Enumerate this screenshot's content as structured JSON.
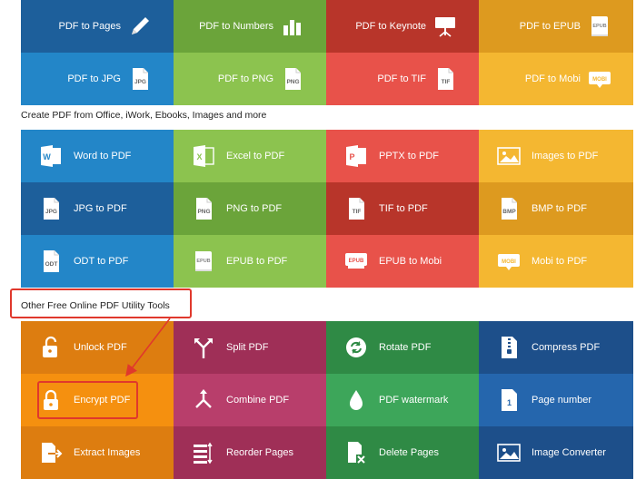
{
  "convert_from_pdf": [
    {
      "label": "PDF to Pages",
      "bg": "#1d5f9b",
      "icon": "pen-icon"
    },
    {
      "label": "PDF to Numbers",
      "bg": "#6ba43a",
      "icon": "bar-chart-icon"
    },
    {
      "label": "PDF to Keynote",
      "bg": "#b8352a",
      "icon": "presentation-icon"
    },
    {
      "label": "PDF to EPUB",
      "bg": "#dd9a1f",
      "icon": "epub-file-icon"
    },
    {
      "label": "PDF to JPG",
      "bg": "#2386c8",
      "icon": "jpg-file-icon",
      "badge": "JPG"
    },
    {
      "label": "PDF to PNG",
      "bg": "#8cc34f",
      "icon": "png-file-icon",
      "badge": "PNG"
    },
    {
      "label": "PDF to TIF",
      "bg": "#e8524a",
      "icon": "tif-file-icon",
      "badge": "TIF"
    },
    {
      "label": "PDF to Mobi",
      "bg": "#f4b731",
      "icon": "mobi-file-icon",
      "badge": "MOBI"
    }
  ],
  "section_create": {
    "title": "Create PDF from Office, iWork, Ebooks, Images and more"
  },
  "create_pdf": [
    {
      "label": "Word to PDF",
      "bg": "#2386c8",
      "icon": "word-icon"
    },
    {
      "label": "Excel to PDF",
      "bg": "#8cc34f",
      "icon": "excel-icon"
    },
    {
      "label": "PPTX to PDF",
      "bg": "#e8524a",
      "icon": "powerpoint-icon"
    },
    {
      "label": "Images to PDF",
      "bg": "#f4b731",
      "icon": "image-icon"
    },
    {
      "label": "JPG to PDF",
      "bg": "#1d5f9b",
      "icon": "jpg-file-icon",
      "badge": "JPG"
    },
    {
      "label": "PNG to PDF",
      "bg": "#6ba43a",
      "icon": "png-file-icon",
      "badge": "PNG"
    },
    {
      "label": "TIF to PDF",
      "bg": "#b8352a",
      "icon": "tif-file-icon",
      "badge": "TIF"
    },
    {
      "label": "BMP to PDF",
      "bg": "#dd9a1f",
      "icon": "bmp-file-icon",
      "badge": "BMP"
    },
    {
      "label": "ODT to PDF",
      "bg": "#2386c8",
      "icon": "odt-file-icon",
      "badge": "ODT"
    },
    {
      "label": "EPUB to PDF",
      "bg": "#8cc34f",
      "icon": "epub-file-icon",
      "badge": "EPUB"
    },
    {
      "label": "EPUB to Mobi",
      "bg": "#e8524a",
      "icon": "epub-book-icon",
      "badge": "EPUB"
    },
    {
      "label": "Mobi to PDF",
      "bg": "#f4b731",
      "icon": "mobi-file-icon",
      "badge": "MOBI"
    }
  ],
  "section_tools": {
    "title": "Other Free Online PDF Utility Tools"
  },
  "tools": [
    {
      "label": "Unlock PDF",
      "bg": "#dd7d10",
      "icon": "unlock-icon"
    },
    {
      "label": "Split PDF",
      "bg": "#9f2f57",
      "icon": "split-icon"
    },
    {
      "label": "Rotate PDF",
      "bg": "#2f8a45",
      "icon": "rotate-icon"
    },
    {
      "label": "Compress PDF",
      "bg": "#1d4f8a",
      "icon": "compress-icon"
    },
    {
      "label": "Encrypt PDF",
      "bg": "#f5900f",
      "icon": "lock-icon"
    },
    {
      "label": "Combine PDF",
      "bg": "#b83e6b",
      "icon": "merge-icon"
    },
    {
      "label": "PDF watermark",
      "bg": "#3da65a",
      "icon": "droplet-icon"
    },
    {
      "label": "Page number",
      "bg": "#2566ad",
      "icon": "page-number-icon"
    },
    {
      "label": "Extract Images",
      "bg": "#dd7d10",
      "icon": "extract-icon"
    },
    {
      "label": "Reorder Pages",
      "bg": "#9f2f57",
      "icon": "reorder-icon"
    },
    {
      "label": "Delete Pages",
      "bg": "#2f8a45",
      "icon": "delete-page-icon"
    },
    {
      "label": "Image Converter",
      "bg": "#1d4f8a",
      "icon": "image-icon"
    }
  ]
}
